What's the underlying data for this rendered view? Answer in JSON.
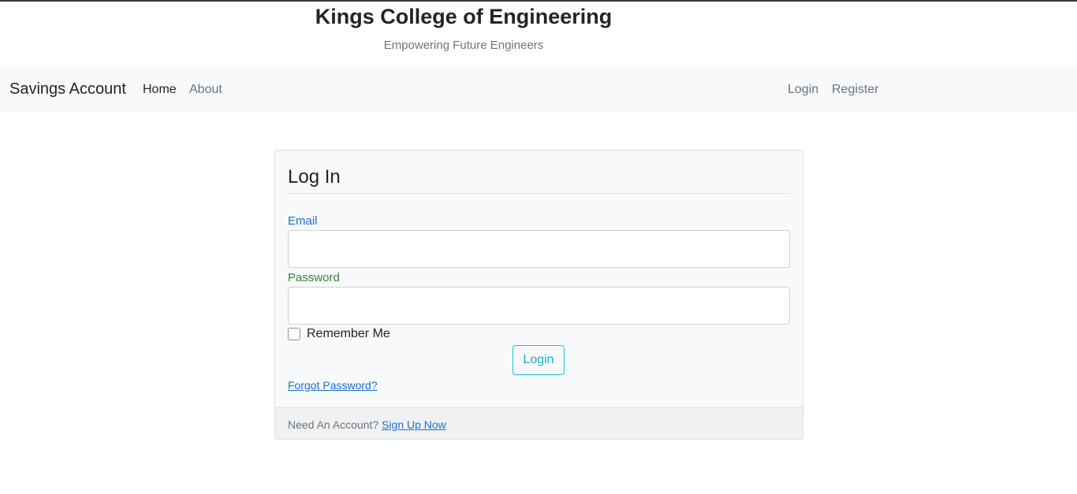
{
  "header": {
    "title": "Kings College of Engineering",
    "tagline": "Empowering Future Engineers"
  },
  "navbar": {
    "brand": "Savings Account",
    "left_links": [
      {
        "label": "Home",
        "active": true
      },
      {
        "label": "About",
        "active": false
      }
    ],
    "right_links": [
      {
        "label": "Login"
      },
      {
        "label": "Register"
      }
    ]
  },
  "login_form": {
    "legend": "Log In",
    "email_label": "Email",
    "email_value": "",
    "password_label": "Password",
    "password_value": "",
    "remember_label": "Remember Me",
    "remember_checked": false,
    "submit_label": "Login",
    "forgot_link": "Forgot Password?",
    "footer_text": "Need An Account?",
    "signup_link": "Sign Up Now"
  },
  "colors": {
    "email_label": "#1a6fd0",
    "password_label": "#2a8a3e",
    "login_button": "#17b0c4",
    "navbar_bg": "#f8f9fa"
  }
}
